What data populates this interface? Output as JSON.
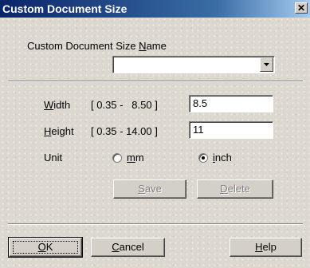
{
  "window": {
    "title": "Custom Document Size",
    "close_glyph": "✕"
  },
  "name_section": {
    "label_prefix": "Custom Document Size ",
    "label_mnemonic": "N",
    "label_suffix": "ame",
    "combo_value": ""
  },
  "width": {
    "label_mnemonic": "W",
    "label_rest": "idth",
    "range": "[ 0.35 -   8.50 ]",
    "value": "8.5"
  },
  "height": {
    "label_mnemonic": "H",
    "label_rest": "eight",
    "range": "[ 0.35 - 14.00 ]",
    "value": "11"
  },
  "unit": {
    "label": "Unit",
    "options": [
      {
        "mnemonic": "m",
        "rest": "m",
        "selected": false
      },
      {
        "mnemonic": "i",
        "rest": "nch",
        "selected": true
      }
    ]
  },
  "actions": {
    "save": {
      "mnemonic": "S",
      "rest": "ave",
      "enabled": false
    },
    "delete": {
      "mnemonic": "D",
      "rest": "elete",
      "enabled": false
    }
  },
  "footer": {
    "ok": {
      "mnemonic": "O",
      "rest": "K"
    },
    "cancel": {
      "mnemonic": "C",
      "rest": "ancel"
    },
    "help": {
      "mnemonic": "H",
      "rest": "elp"
    }
  },
  "colors": {
    "titlebar_start": "#0a246a",
    "titlebar_end": "#a6caf0",
    "face": "#d4d0c8"
  }
}
